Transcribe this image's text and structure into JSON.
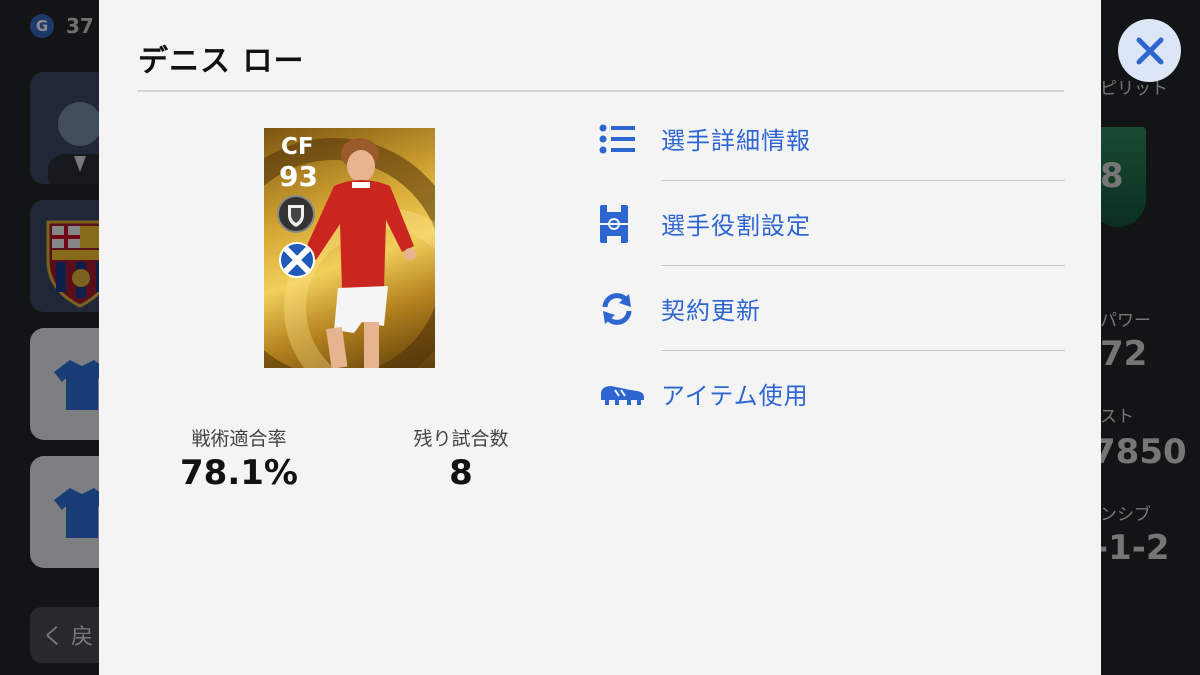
{
  "background": {
    "currency_icon": "G",
    "currency_value": "37",
    "back_label": "く 戻",
    "right_labels": [
      "ピリット",
      "8",
      "パワー",
      "72",
      "スト",
      "7850",
      "ンシブ",
      "-1-2"
    ]
  },
  "dialog": {
    "title": "デニス ロー",
    "card": {
      "position": "CF",
      "rating": "93",
      "badge_icon": "legend-badge-icon",
      "flag_icon": "scotland-flag-icon"
    },
    "stats": [
      {
        "label": "戦術適合率",
        "value": "78.1%"
      },
      {
        "label": "残り試合数",
        "value": "8"
      }
    ],
    "menu": [
      {
        "label": "選手詳細情報",
        "icon": "list-icon"
      },
      {
        "label": "選手役割設定",
        "icon": "pitch-icon"
      },
      {
        "label": "契約更新",
        "icon": "refresh-icon"
      },
      {
        "label": "アイテム使用",
        "icon": "boot-icon"
      }
    ],
    "close_icon": "close-icon"
  },
  "colors": {
    "accent": "#2e66d1",
    "modal_bg": "#f4f4f4",
    "close_bg": "#dce6f6"
  }
}
